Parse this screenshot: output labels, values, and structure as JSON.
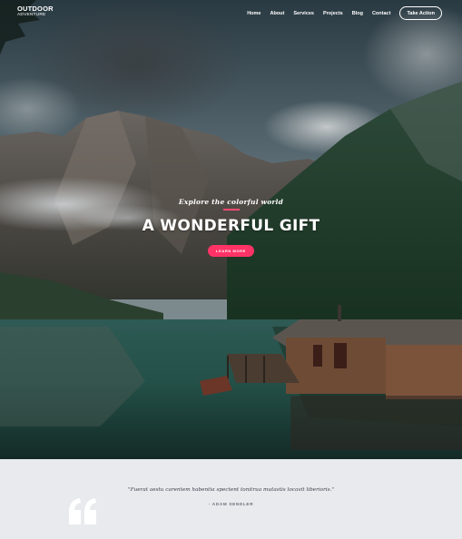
{
  "brand": {
    "line1": "OUTDOOR",
    "line2": "ADVENTURE"
  },
  "nav": {
    "items": [
      "Home",
      "About",
      "Services",
      "Projects",
      "Blog",
      "Contact"
    ],
    "cta": "Take Action"
  },
  "hero": {
    "eyebrow": "Explore the colorful world",
    "headline": "A WONDERFUL GIFT",
    "button": "LEARN MORE"
  },
  "testimonial": {
    "quote": "\"Fuerat aestu carentem habentia spectent tonitrua mutastis locavit liberioris.\"",
    "author": "- ADAM SENDLER"
  },
  "colors": {
    "accent": "#ff3366",
    "band": "#e9eaee"
  }
}
